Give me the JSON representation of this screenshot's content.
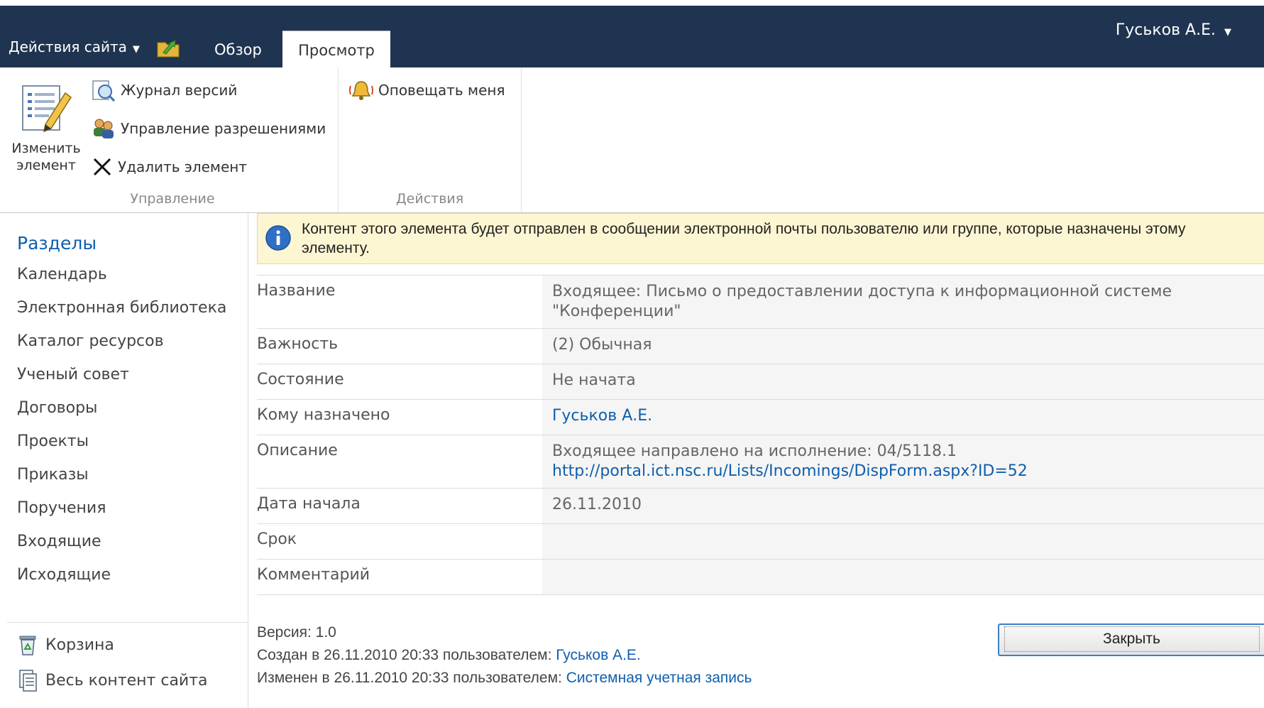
{
  "header": {
    "site_actions": "Действия сайта",
    "tabs": [
      {
        "label": "Обзор"
      },
      {
        "label": "Просмотр"
      }
    ],
    "user": "Гуськов А.Е."
  },
  "ribbon": {
    "manage": {
      "label": "Управление",
      "edit_item": "Изменить элемент",
      "version_history": "Журнал версий",
      "manage_permissions": "Управление разрешениями",
      "delete_item": "Удалить элемент"
    },
    "actions": {
      "label": "Действия",
      "alert_me": "Оповещать меня"
    }
  },
  "leftnav": {
    "header": "Разделы",
    "items": [
      "Календарь",
      "Электронная библиотека",
      "Каталог ресурсов",
      "Ученый совет",
      "Договоры",
      "Проекты",
      "Приказы",
      "Поручения",
      "Входящие",
      "Исходящие"
    ],
    "recycle_bin": "Корзина",
    "all_content": "Весь контент сайта"
  },
  "info_message": "Контент этого элемента будет отправлен в сообщении электронной почты пользователю или группе, которые назначены этому элементу.",
  "properties": [
    {
      "label": "Название",
      "value": "Входящее:  Письмо о предоставлении доступа к информационной системе \"Конференции\""
    },
    {
      "label": "Важность",
      "value": "(2) Обычная"
    },
    {
      "label": "Состояние",
      "value": "Не начата"
    },
    {
      "label": "Кому назначено",
      "value": "Гуськов А.Е.",
      "link": true
    },
    {
      "label": "Описание",
      "value": "Входящее направлено на исполнение: 04/5118.1",
      "url": "http://portal.ict.nsc.ru/Lists/Incomings/DispForm.aspx?ID=52"
    },
    {
      "label": "Дата начала",
      "value": "26.11.2010"
    },
    {
      "label": "Срок",
      "value": ""
    },
    {
      "label": "Комментарий",
      "value": ""
    }
  ],
  "meta": {
    "version": "Версия: 1.0",
    "created_prefix": "Создан в 26.11.2010 20:33 пользователем: ",
    "created_by": "Гуськов А.Е.",
    "modified_prefix": "Изменен в 26.11.2010 20:33 пользователем: ",
    "modified_by": "Системная учетная запись"
  },
  "close_label": "Закрыть",
  "colors": {
    "top_bar": "#1f3450",
    "link": "#0f5fad",
    "info_bg": "#fdf6d3"
  }
}
